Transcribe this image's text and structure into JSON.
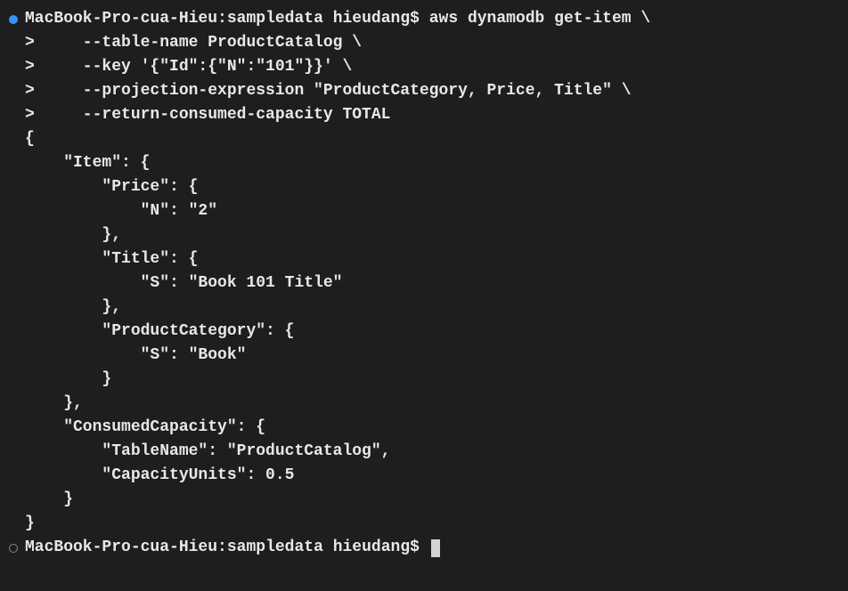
{
  "prompt1": {
    "host": "MacBook-Pro-cua-Hieu",
    "dir": "sampledata",
    "user": "hieudang",
    "command": "aws dynamodb get-item \\"
  },
  "continuation": [
    ">     --table-name ProductCatalog \\",
    ">     --key '{\"Id\":{\"N\":\"101\"}}' \\",
    ">     --projection-expression \"ProductCategory, Price, Title\" \\",
    ">     --return-consumed-capacity TOTAL"
  ],
  "output": [
    "{",
    "    \"Item\": {",
    "        \"Price\": {",
    "            \"N\": \"2\"",
    "        },",
    "        \"Title\": {",
    "            \"S\": \"Book 101 Title\"",
    "        },",
    "        \"ProductCategory\": {",
    "            \"S\": \"Book\"",
    "        }",
    "    },",
    "    \"ConsumedCapacity\": {",
    "        \"TableName\": \"ProductCatalog\",",
    "        \"CapacityUnits\": 0.5",
    "    }",
    "}"
  ],
  "prompt2": {
    "host": "MacBook-Pro-cua-Hieu",
    "dir": "sampledata",
    "user": "hieudang"
  }
}
